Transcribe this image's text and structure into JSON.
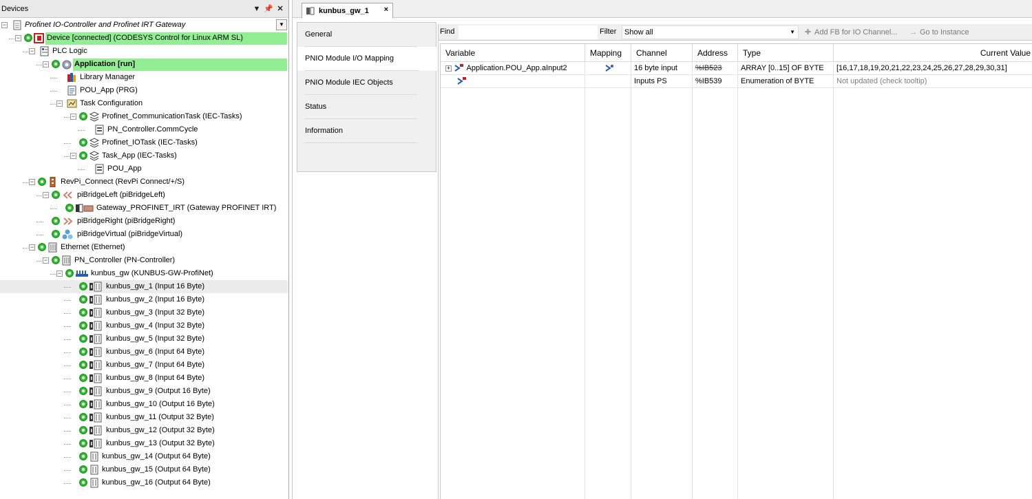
{
  "devices_panel": {
    "title": "Devices",
    "pin": "↓",
    "pin2": "#",
    "close": "✕",
    "tree": [
      {
        "label": "Profinet IO-Controller and Profinet IRT Gateway",
        "level": 0,
        "icon": "project-icon",
        "status": false,
        "expander": "minus",
        "style": "italic"
      },
      {
        "label": "Device [connected] (CODESYS Control for Linux ARM SL)",
        "level": 1,
        "icon": "plc-device-icon",
        "status": true,
        "expander": "minus",
        "style": "highlight"
      },
      {
        "label": "PLC Logic",
        "level": 2,
        "icon": "plc-logic-icon",
        "status": false,
        "expander": "minus",
        "style": "normal"
      },
      {
        "label": "Application [run]",
        "level": 3,
        "icon": "application-icon",
        "status": true,
        "expander": "minus",
        "style": "bold-highlight"
      },
      {
        "label": "Library Manager",
        "level": 4,
        "icon": "library-manager-icon",
        "status": false,
        "expander": "none",
        "style": "normal"
      },
      {
        "label": "POU_App (PRG)",
        "level": 4,
        "icon": "pou-icon",
        "status": false,
        "expander": "none",
        "style": "normal"
      },
      {
        "label": "Task Configuration",
        "level": 4,
        "icon": "task-configuration-icon",
        "status": false,
        "expander": "minus",
        "style": "normal"
      },
      {
        "label": "Profinet_CommunicationTask (IEC-Tasks)",
        "level": 5,
        "icon": "task-icon",
        "status": true,
        "expander": "minus",
        "style": "normal"
      },
      {
        "label": "PN_Controller.CommCycle",
        "level": 6,
        "icon": "program-call-icon",
        "status": false,
        "expander": "none",
        "style": "normal"
      },
      {
        "label": "Profinet_IOTask (IEC-Tasks)",
        "level": 5,
        "icon": "task-icon",
        "status": true,
        "expander": "none",
        "style": "normal"
      },
      {
        "label": "Task_App (IEC-Tasks)",
        "level": 5,
        "icon": "task-icon",
        "status": true,
        "expander": "minus",
        "style": "normal"
      },
      {
        "label": "POU_App",
        "level": 6,
        "icon": "program-call-icon",
        "status": false,
        "expander": "none",
        "style": "normal"
      },
      {
        "label": "RevPi_Connect (RevPi Connect/+/S)",
        "level": 2,
        "icon": "revpi-connect-icon",
        "status": true,
        "expander": "minus",
        "style": "normal"
      },
      {
        "label": "piBridgeLeft (piBridgeLeft)",
        "level": 3,
        "icon": "pibridge-left-icon",
        "status": true,
        "expander": "minus",
        "style": "normal"
      },
      {
        "label": "Gateway_PROFINET_IRT (Gateway PROFINET IRT)",
        "level": 4,
        "icon": "gateway-module-icon",
        "status": true,
        "expander": "none",
        "style": "normal"
      },
      {
        "label": "piBridgeRight (piBridgeRight)",
        "level": 3,
        "icon": "pibridge-right-icon",
        "status": true,
        "expander": "none",
        "style": "normal"
      },
      {
        "label": "piBridgeVirtual (piBridgeVirtual)",
        "level": 3,
        "icon": "pibridge-virtual-icon",
        "status": true,
        "expander": "none",
        "style": "normal"
      },
      {
        "label": "Ethernet (Ethernet)",
        "level": 2,
        "icon": "ethernet-icon",
        "status": true,
        "expander": "minus",
        "style": "normal"
      },
      {
        "label": "PN_Controller (PN-Controller)",
        "level": 3,
        "icon": "pn-controller-icon",
        "status": true,
        "expander": "minus",
        "style": "normal"
      },
      {
        "label": "kunbus_gw (KUNBUS-GW-ProfiNet)",
        "level": 4,
        "icon": "profinet-device-icon",
        "status": true,
        "expander": "minus",
        "style": "normal"
      },
      {
        "label": "kunbus_gw_1 (Input 16 Byte)",
        "level": 5,
        "icon": "io-module-icon",
        "status": true,
        "expander": "none",
        "style": "selected"
      },
      {
        "label": "kunbus_gw_2 (Input 16 Byte)",
        "level": 5,
        "icon": "io-module-icon",
        "status": true,
        "expander": "none",
        "style": "normal"
      },
      {
        "label": "kunbus_gw_3 (Input 32 Byte)",
        "level": 5,
        "icon": "io-module-icon",
        "status": true,
        "expander": "none",
        "style": "normal"
      },
      {
        "label": "kunbus_gw_4 (Input 32 Byte)",
        "level": 5,
        "icon": "io-module-icon",
        "status": true,
        "expander": "none",
        "style": "normal"
      },
      {
        "label": "kunbus_gw_5 (Input 32 Byte)",
        "level": 5,
        "icon": "io-module-icon",
        "status": true,
        "expander": "none",
        "style": "normal"
      },
      {
        "label": "kunbus_gw_6 (Input 64 Byte)",
        "level": 5,
        "icon": "io-module-icon",
        "status": true,
        "expander": "none",
        "style": "normal"
      },
      {
        "label": "kunbus_gw_7 (Input 64 Byte)",
        "level": 5,
        "icon": "io-module-icon",
        "status": true,
        "expander": "none",
        "style": "normal"
      },
      {
        "label": "kunbus_gw_8 (Input 64 Byte)",
        "level": 5,
        "icon": "io-module-icon",
        "status": true,
        "expander": "none",
        "style": "normal"
      },
      {
        "label": "kunbus_gw_9 (Output 16 Byte)",
        "level": 5,
        "icon": "io-module-icon",
        "status": true,
        "expander": "none",
        "style": "normal"
      },
      {
        "label": "kunbus_gw_10 (Output 16 Byte)",
        "level": 5,
        "icon": "io-module-icon",
        "status": true,
        "expander": "none",
        "style": "normal"
      },
      {
        "label": "kunbus_gw_11 (Output 32 Byte)",
        "level": 5,
        "icon": "io-module-icon",
        "status": true,
        "expander": "none",
        "style": "normal"
      },
      {
        "label": "kunbus_gw_12 (Output 32 Byte)",
        "level": 5,
        "icon": "io-module-icon",
        "status": true,
        "expander": "none",
        "style": "normal"
      },
      {
        "label": "kunbus_gw_13 (Output 32 Byte)",
        "level": 5,
        "icon": "io-module-icon",
        "status": true,
        "expander": "none",
        "style": "normal"
      },
      {
        "label": "kunbus_gw_14 (Output 64 Byte)",
        "level": 5,
        "icon": "io-module-plain-icon",
        "status": true,
        "expander": "none",
        "style": "normal"
      },
      {
        "label": "kunbus_gw_15 (Output 64 Byte)",
        "level": 5,
        "icon": "io-module-plain-icon",
        "status": true,
        "expander": "none",
        "style": "normal"
      },
      {
        "label": "kunbus_gw_16 (Output 64 Byte)",
        "level": 5,
        "icon": "io-module-plain-icon",
        "status": true,
        "expander": "none",
        "style": "normal"
      }
    ]
  },
  "editor": {
    "tab": {
      "label": "kunbus_gw_1",
      "close": "×"
    },
    "side_tabs": [
      {
        "label": "General",
        "active": false
      },
      {
        "label": "PNIO Module I/O Mapping",
        "active": true
      },
      {
        "label": "PNIO Module IEC Objects",
        "active": false
      },
      {
        "label": "Status",
        "active": false
      },
      {
        "label": "Information",
        "active": false
      }
    ],
    "toolbar": {
      "find_label": "Find",
      "find_value": "",
      "filter_label": "Filter",
      "filter_value": "Show all",
      "add_fb_label": "Add FB for IO Channel...",
      "goto_label": "Go to Instance"
    },
    "table": {
      "columns": [
        "Variable",
        "Mapping",
        "Channel",
        "Address",
        "Type",
        "Current Value"
      ],
      "rows": [
        {
          "variable": "Application.POU_App.aInput2",
          "mapping": "mapped",
          "channel": "16 byte input",
          "address": "%IB523",
          "address_struck": true,
          "type": "ARRAY [0..15] OF BYTE",
          "current_value": "[16,17,18,19,20,21,22,23,24,25,26,27,28,29,30,31]",
          "value_muted": false
        },
        {
          "variable": "",
          "mapping": "",
          "channel": "Inputs PS",
          "address": "%IB539",
          "address_struck": false,
          "type": "Enumeration of BYTE",
          "current_value": "Not updated (check tooltip)",
          "value_muted": true
        }
      ]
    }
  },
  "colors": {
    "running_highlight": "#92ee92",
    "status_green": "#3fc53f",
    "selected_row": "#ececec",
    "panel_bg": "#f0f0f0"
  }
}
